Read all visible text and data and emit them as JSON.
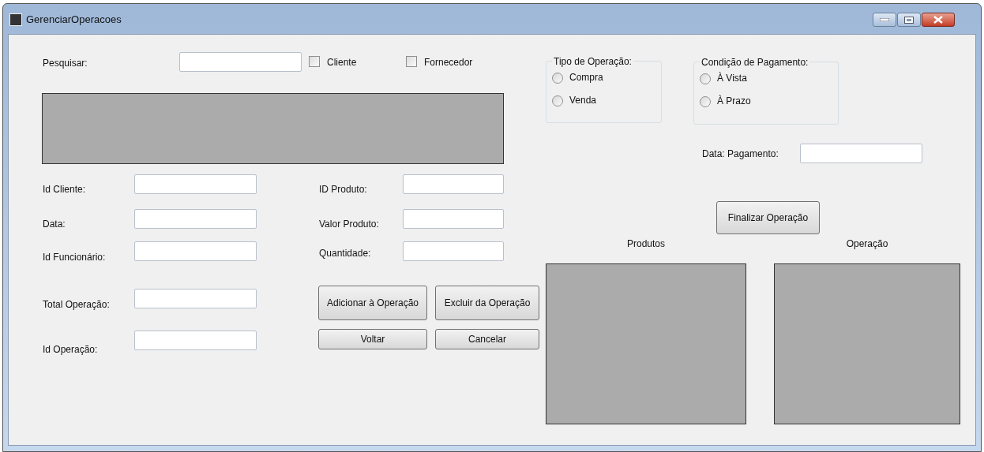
{
  "window": {
    "title": "GerenciarOperacoes"
  },
  "search": {
    "label": "Pesquisar:",
    "filters": [
      {
        "label": "Cliente",
        "checked": false
      },
      {
        "label": "Fornecedor",
        "checked": false
      }
    ]
  },
  "left_fields": [
    {
      "label": "Id Cliente:"
    },
    {
      "label": "Data:"
    },
    {
      "label": "Id Funcionário:"
    },
    {
      "label": "Total Operação:"
    },
    {
      "label": "Id Operação:"
    }
  ],
  "product_fields": [
    {
      "label": "ID Produto:"
    },
    {
      "label": "Valor Produto:"
    },
    {
      "label": "Quantidade:"
    }
  ],
  "item_buttons": [
    "Adicionar à Operação",
    "Excluir da Operação",
    "Voltar",
    "Cancelar"
  ],
  "operation_type": {
    "title": "Tipo de Operação:",
    "options": [
      {
        "label": "Compra",
        "selected": false
      },
      {
        "label": "Venda",
        "selected": false
      }
    ]
  },
  "payment_condition": {
    "title": "Condição de Pagamento:",
    "options": [
      {
        "label": "À Vista",
        "selected": false
      },
      {
        "label": "À Prazo",
        "selected": false
      }
    ]
  },
  "payment_date": {
    "label": "Data: Pagamento:"
  },
  "finish_button": "Finalizar Operação",
  "lists": [
    {
      "title": "Produtos"
    },
    {
      "title": "Operação"
    }
  ]
}
